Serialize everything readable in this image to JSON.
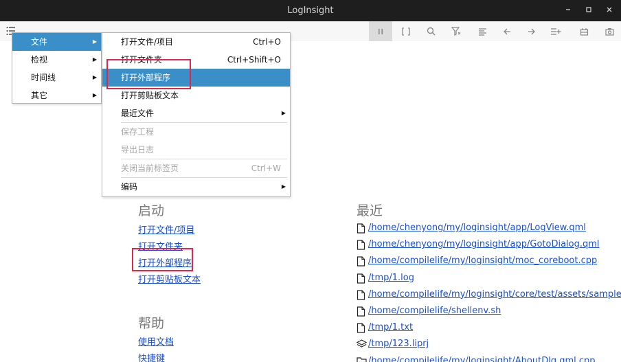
{
  "window": {
    "title": "LogInsight"
  },
  "main_menu": {
    "items": [
      {
        "label": "文件"
      },
      {
        "label": "检视"
      },
      {
        "label": "时间线"
      },
      {
        "label": "其它"
      }
    ]
  },
  "file_menu": {
    "items": [
      {
        "label": "打开文件/项目",
        "shortcut": "Ctrl+O"
      },
      {
        "label": "打开文件夹",
        "shortcut": "Ctrl+Shift+O"
      },
      {
        "label": "打开外部程序"
      },
      {
        "label": "打开剪贴板文本"
      },
      {
        "label": "最近文件"
      },
      {
        "label": "保存工程"
      },
      {
        "label": "导出日志"
      },
      {
        "label": "关闭当前标签页",
        "shortcut": "Ctrl+W"
      },
      {
        "label": "编码"
      }
    ]
  },
  "startup": {
    "title": "启动",
    "links": [
      "打开文件/项目",
      "打开文件夹",
      "打开外部程序",
      "打开剪贴板文本"
    ]
  },
  "help": {
    "title": "帮助",
    "links": [
      "使用文档",
      "快捷键"
    ]
  },
  "recent": {
    "title": "最近",
    "items": [
      {
        "path": "/home/chenyong/my/loginsight/app/LogView.qml",
        "icon": "file-icon"
      },
      {
        "path": "/home/chenyong/my/loginsight/app/GotoDialog.qml",
        "icon": "file-icon"
      },
      {
        "path": "/home/compilelife/my/loginsight/moc_coreboot.cpp",
        "icon": "file-icon"
      },
      {
        "path": "/tmp/1.log",
        "icon": "file-icon"
      },
      {
        "path": "/home/compilelife/my/loginsight/core/test/assets/sample.lo",
        "icon": "file-icon"
      },
      {
        "path": "/home/compilelife/shellenv.sh",
        "icon": "file-icon"
      },
      {
        "path": "/tmp/1.txt",
        "icon": "file-icon"
      },
      {
        "path": "/tmp/123.liprj",
        "icon": "layers-icon"
      },
      {
        "path": "/home/compilelife/my/loginsight/AboutDlg.qml.cpp",
        "icon": "folder-icon"
      }
    ]
  },
  "colors": {
    "selected": "#3a8fc9",
    "highlight_box": "#e0274a",
    "link": "#1a4fd1"
  }
}
